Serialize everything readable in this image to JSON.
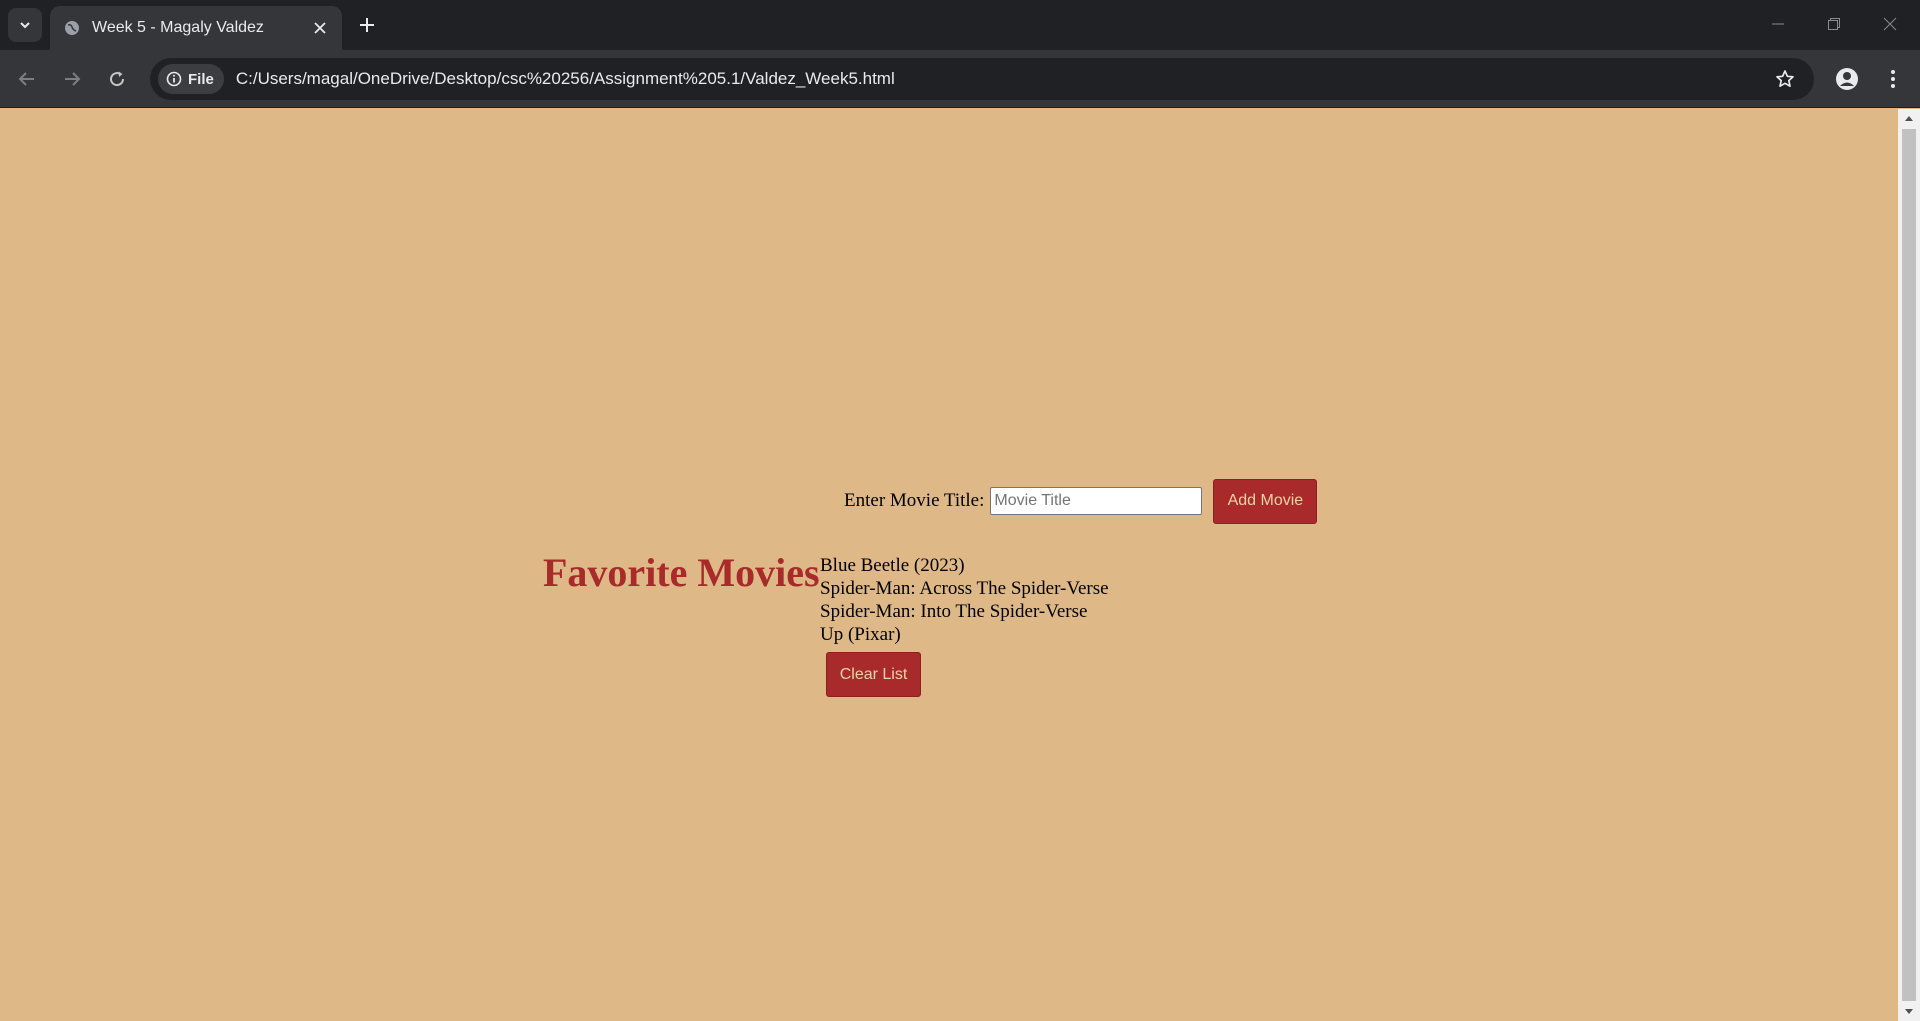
{
  "browser": {
    "tab_title": "Week 5 - Magaly Valdez",
    "site_chip_label": "File",
    "url": "C:/Users/magal/OneDrive/Desktop/csc%20256/Assignment%205.1/Valdez_Week5.html"
  },
  "page": {
    "input_label": "Enter Movie Title:",
    "input_placeholder": "Movie Title",
    "input_value": "",
    "add_button_label": "Add Movie",
    "heading": "Favorite Movies",
    "movies": [
      "Blue Beetle (2023)",
      "Spider-Man: Across The Spider-Verse",
      "Spider-Man: Into The Spider-Verse",
      "Up (Pixar)"
    ],
    "clear_button_label": "Clear List"
  },
  "colors": {
    "page_background": "#dfb887",
    "accent_red": "#a82a2a",
    "button_text": "#f3d2a8"
  }
}
